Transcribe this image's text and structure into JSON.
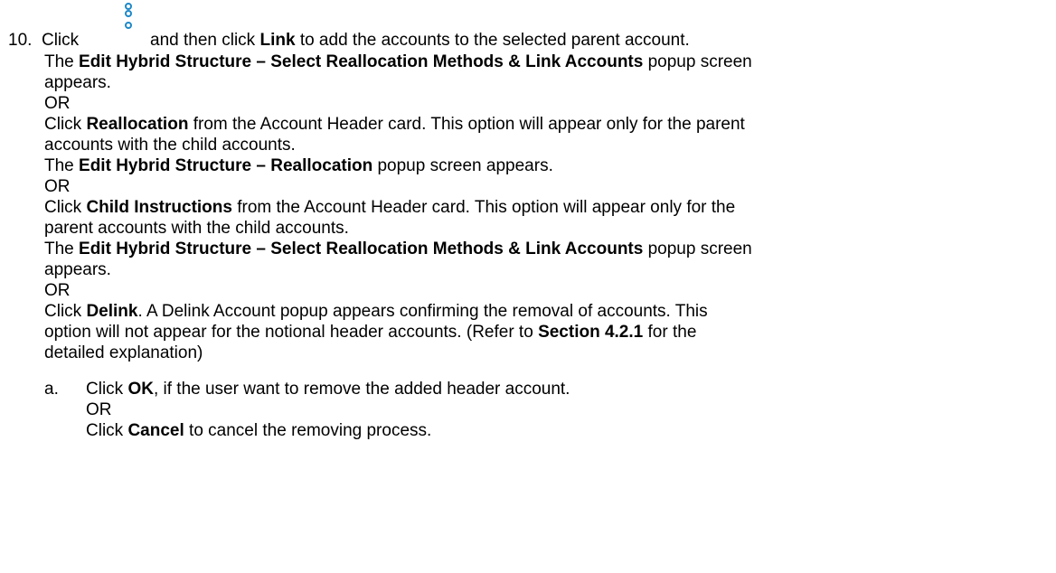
{
  "step": {
    "number": "10.",
    "click_word": "Click",
    "after_icon_1": "and then click",
    "link_label": "Link",
    "after_icon_2": "to add the accounts to the selected parent account."
  },
  "p1": {
    "pre": "The",
    "bold": "Edit Hybrid Structure – Select Reallocation Methods & Link Accounts",
    "post": "popup screen",
    "cont": "appears."
  },
  "or_label": "OR",
  "p2": {
    "pre": "Click",
    "bold": "Reallocation",
    "post": "from the Account Header card. This option will appear only for the parent",
    "cont": "accounts with the child accounts."
  },
  "p3": {
    "pre": "The",
    "bold": "Edit Hybrid Structure – Reallocation",
    "post": "popup screen appears."
  },
  "p4": {
    "pre": "Click",
    "bold": "Child Instructions",
    "post": "from the Account Header card. This option will appear only for the",
    "cont": "parent accounts with the child accounts."
  },
  "p5": {
    "pre": "The",
    "bold": "Edit Hybrid Structure – Select Reallocation Methods & Link Accounts",
    "post": "popup screen",
    "cont": "appears."
  },
  "p6": {
    "pre": "Click",
    "bold": "Delink",
    "post": ". A Delink Account popup appears confirming the removal of accounts. This",
    "line2": "option will not appear for the notional header accounts. (Refer to",
    "line2_bold": "Section 4.2.1",
    "line2_post": "for the",
    "line3": "detailed explanation)"
  },
  "sub_a": {
    "letter": "a.",
    "pre": "Click",
    "bold": "OK",
    "post": ", if the user want to remove the added header account.",
    "or": "OR",
    "cancel_pre": "Click",
    "cancel_bold": "Cancel",
    "cancel_post": "to cancel the removing process."
  },
  "icon": {
    "name": "vertical-dots-icon",
    "color": "#1E88C8"
  }
}
